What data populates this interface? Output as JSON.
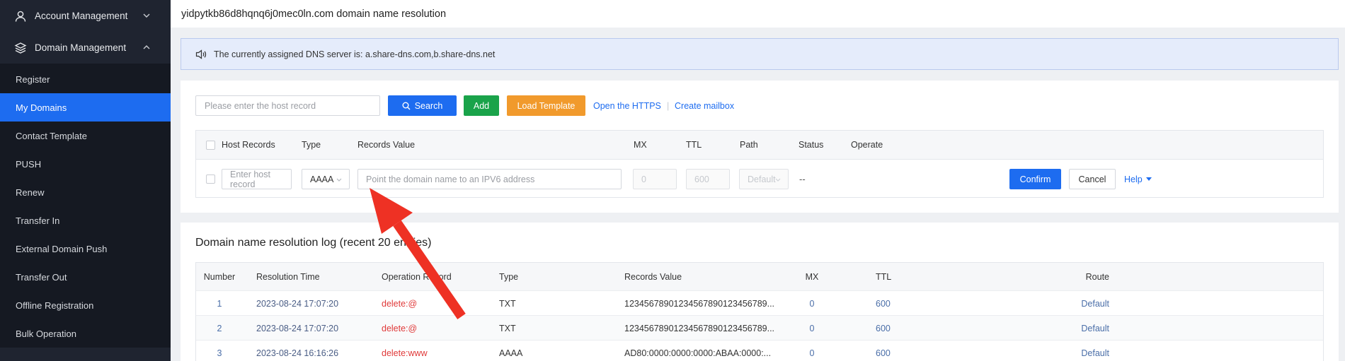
{
  "sidebar": {
    "groups": [
      {
        "label": "Account Management",
        "icon": "user-icon",
        "expanded": false
      },
      {
        "label": "Domain Management",
        "icon": "layers-icon",
        "expanded": true
      }
    ],
    "items": [
      {
        "label": "Register"
      },
      {
        "label": "My Domains",
        "active": true
      },
      {
        "label": "Contact Template"
      },
      {
        "label": "PUSH"
      },
      {
        "label": "Renew"
      },
      {
        "label": "Transfer In"
      },
      {
        "label": "External Domain Push"
      },
      {
        "label": "Transfer Out"
      },
      {
        "label": "Offline Registration"
      },
      {
        "label": "Bulk Operation"
      }
    ]
  },
  "header": {
    "title": "yidpytkb86d8hqnq6j0mec0ln.com domain name resolution"
  },
  "notice": {
    "icon": "speaker-icon",
    "text": "The currently assigned DNS server is: a.share-dns.com,b.share-dns.net"
  },
  "toolbar": {
    "search_placeholder": "Please enter the host record",
    "search_label": "Search",
    "add_label": "Add",
    "template_label": "Load Template",
    "https_label": "Open the HTTPS",
    "separator": "|",
    "mailbox_label": "Create mailbox"
  },
  "editor": {
    "columns": [
      "Host Records",
      "Type",
      "Records Value",
      "MX",
      "TTL",
      "Path",
      "Status",
      "Operate"
    ],
    "host_placeholder": "Enter host record",
    "type_value": "AAAA",
    "value_placeholder": "Point the domain name to an IPV6 address",
    "mx_value": "0",
    "ttl_value": "600",
    "path_value": "Default",
    "status_value": "--",
    "confirm_label": "Confirm",
    "cancel_label": "Cancel",
    "help_label": "Help"
  },
  "log": {
    "title": "Domain name resolution log (recent 20 entries)",
    "columns": [
      "Number",
      "Resolution Time",
      "Operation Record",
      "Type",
      "Records Value",
      "MX",
      "TTL",
      "Route"
    ],
    "rows": [
      {
        "number": "1",
        "time": "2023-08-24 17:07:20",
        "op": "delete:@",
        "type": "TXT",
        "value": "12345678901234567890123456789...",
        "mx": "0",
        "ttl": "600",
        "route": "Default"
      },
      {
        "number": "2",
        "time": "2023-08-24 17:07:20",
        "op": "delete:@",
        "type": "TXT",
        "value": "12345678901234567890123456789...",
        "mx": "0",
        "ttl": "600",
        "route": "Default"
      },
      {
        "number": "3",
        "time": "2023-08-24 16:16:26",
        "op": "delete:www",
        "type": "AAAA",
        "value": "AD80:0000:0000:0000:ABAA:0000:...",
        "mx": "0",
        "ttl": "600",
        "route": "Default"
      }
    ]
  },
  "colors": {
    "sidebar_bg": "#1f2430",
    "active": "#1d6cf0",
    "add": "#1aa34a",
    "template": "#f19a2c",
    "delete_text": "#e03a3a",
    "arrow": "#ee3124"
  }
}
